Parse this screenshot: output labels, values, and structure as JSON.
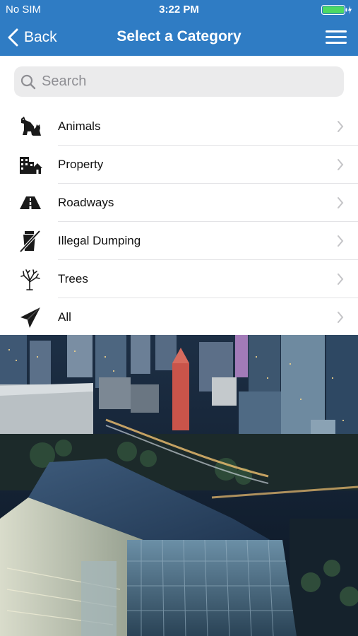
{
  "status_bar": {
    "carrier": "No SIM",
    "time": "3:22 PM"
  },
  "nav": {
    "back_label": "Back",
    "title": "Select a Category"
  },
  "search": {
    "placeholder": "Search",
    "value": ""
  },
  "categories": [
    {
      "label": "Animals",
      "icon": "dog-cat-icon"
    },
    {
      "label": "Property",
      "icon": "buildings-house-icon"
    },
    {
      "label": "Roadways",
      "icon": "road-icon"
    },
    {
      "label": "Illegal Dumping",
      "icon": "no-dumping-icon"
    },
    {
      "label": "Trees",
      "icon": "tree-icon"
    },
    {
      "label": "All",
      "icon": "paper-plane-icon"
    }
  ],
  "colors": {
    "nav_blue": "#2f7cc4",
    "battery_green": "#4cd964"
  }
}
